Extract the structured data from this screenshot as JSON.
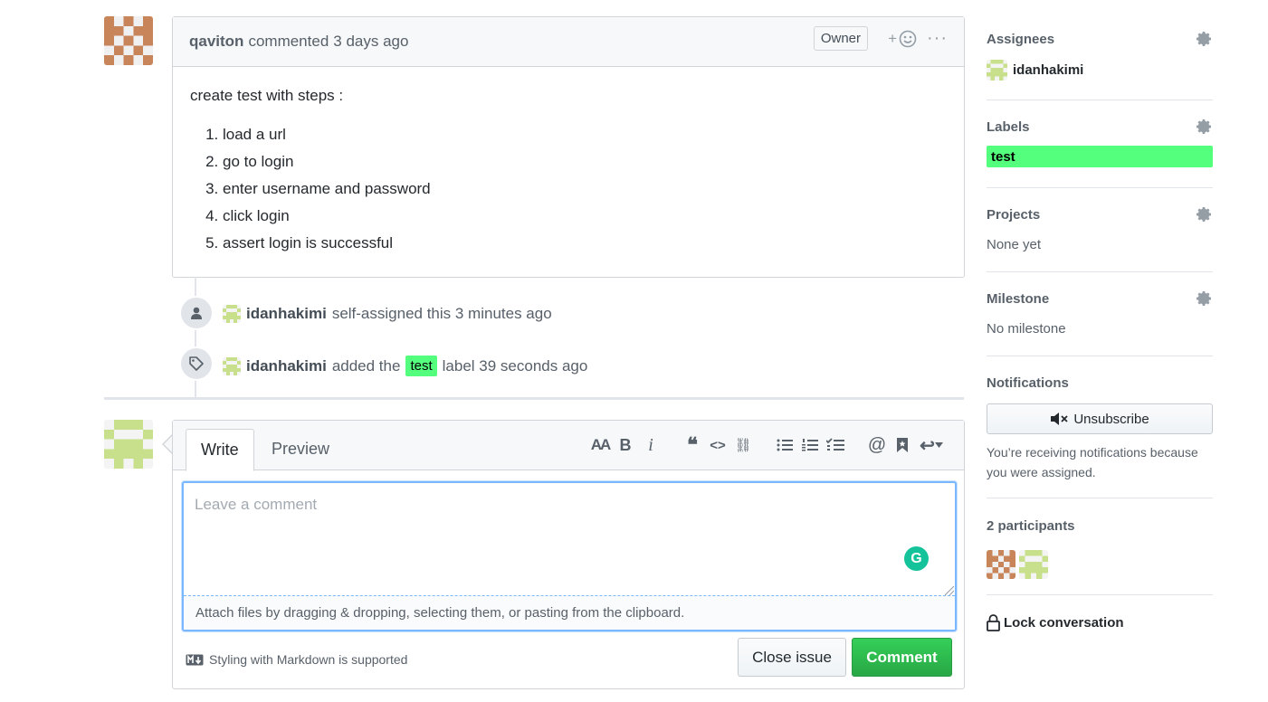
{
  "issue_comment": {
    "author": "qaviton",
    "action": "commented",
    "time": "3 days ago",
    "badge": "Owner",
    "reaction_glyph": "+",
    "more_glyph": "···",
    "intro": "create test with steps :",
    "steps": [
      "load a url",
      "go to login",
      "enter username and password",
      "click login",
      "assert login is successful"
    ]
  },
  "timeline": [
    {
      "actor": "idanhakimi",
      "text": "self-assigned this 3 minutes ago",
      "icon": "person-icon"
    },
    {
      "actor": "idanhakimi",
      "text_before": "added the",
      "label": "test",
      "text_after": "label 39 seconds ago",
      "icon": "tag-icon"
    }
  ],
  "form": {
    "tab_write": "Write",
    "tab_preview": "Preview",
    "placeholder": "Leave a comment",
    "attach_hint": "Attach files by dragging & dropping, selecting them, or pasting from the clipboard.",
    "markdown_note": "Styling with Markdown is supported",
    "close_button": "Close issue",
    "comment_button": "Comment",
    "toolbar": {
      "header": "AA",
      "bold": "B",
      "italic": "i",
      "quote": "❝",
      "code": "<>",
      "link": "⛓",
      "mention": "@",
      "reply": "↩"
    }
  },
  "sidebar": {
    "assignees": {
      "title": "Assignees",
      "value": "idanhakimi"
    },
    "labels": {
      "title": "Labels",
      "value": "test",
      "color": "#55ff7e"
    },
    "projects": {
      "title": "Projects",
      "value": "None yet"
    },
    "milestone": {
      "title": "Milestone",
      "value": "No milestone"
    },
    "notifications": {
      "title": "Notifications",
      "button": "Unsubscribe",
      "note": "You’re receiving notifications because you were assigned."
    },
    "participants": {
      "title": "2 participants"
    },
    "lock": "Lock conversation"
  }
}
